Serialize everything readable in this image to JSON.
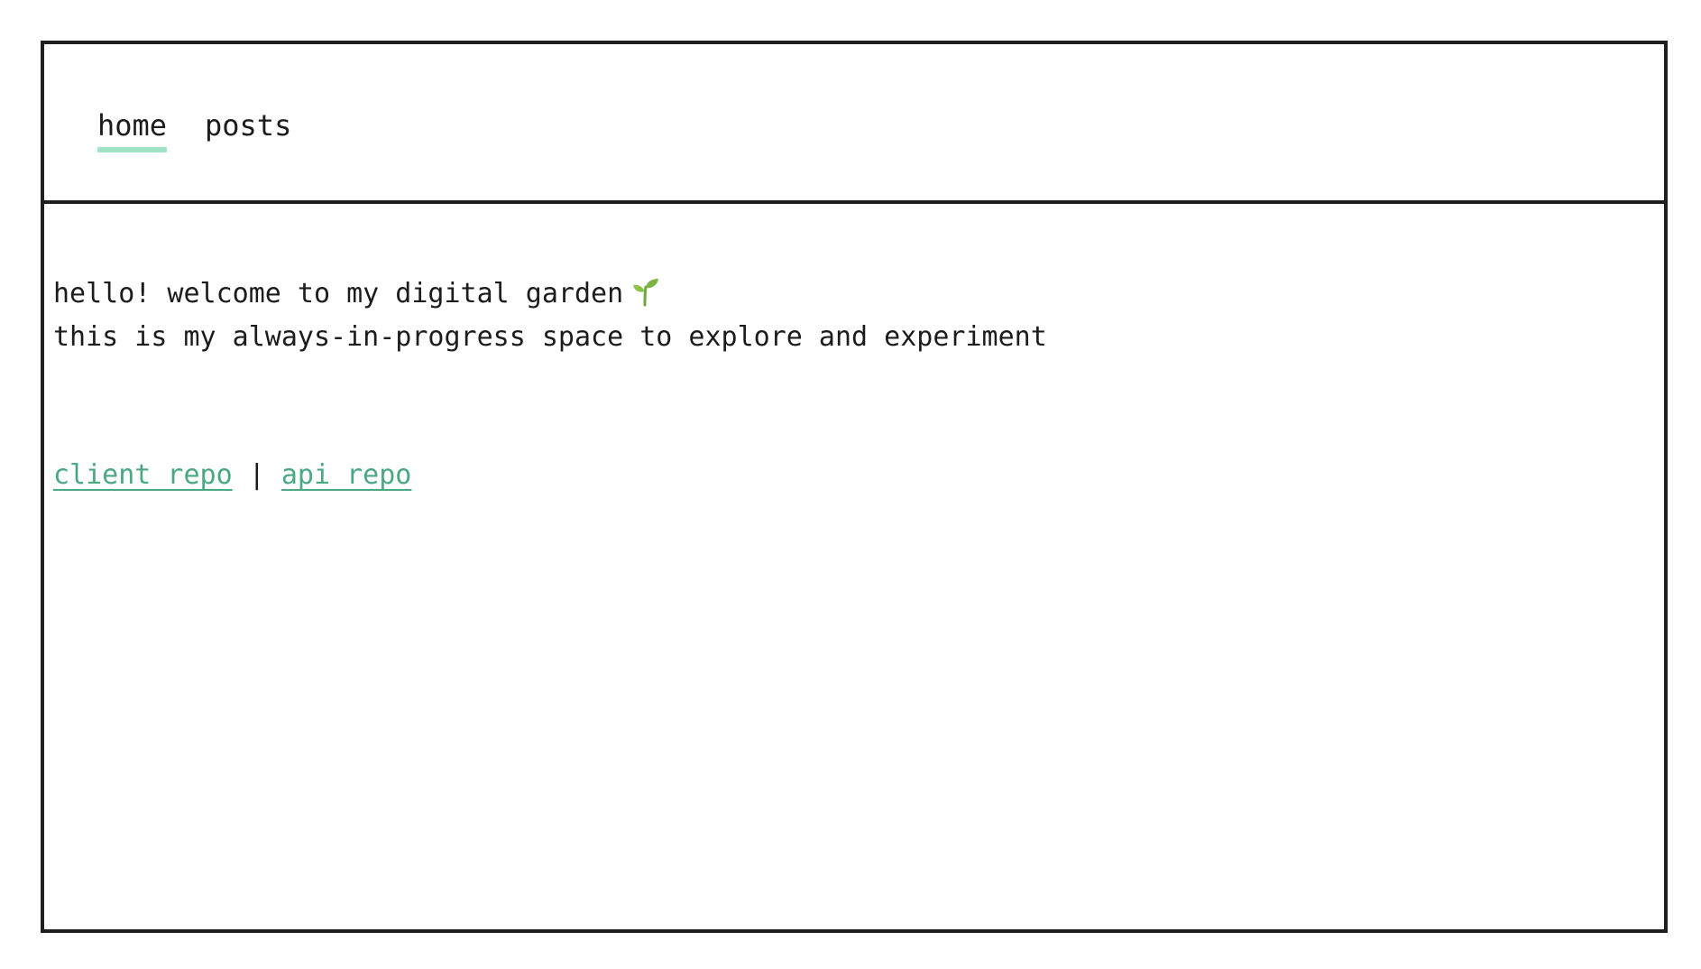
{
  "nav": {
    "items": [
      {
        "label": "home",
        "active": true
      },
      {
        "label": "posts",
        "active": false
      }
    ],
    "active_underline_color": "#9fe3c4"
  },
  "main": {
    "greeting": "hello! welcome to my digital garden",
    "greeting_icon": "seedling-icon",
    "tagline": "this is my always-in-progress space to explore and experiment",
    "links": {
      "client_repo": "client repo",
      "separator": "|",
      "api_repo": "api repo",
      "color": "#4aa882"
    }
  }
}
